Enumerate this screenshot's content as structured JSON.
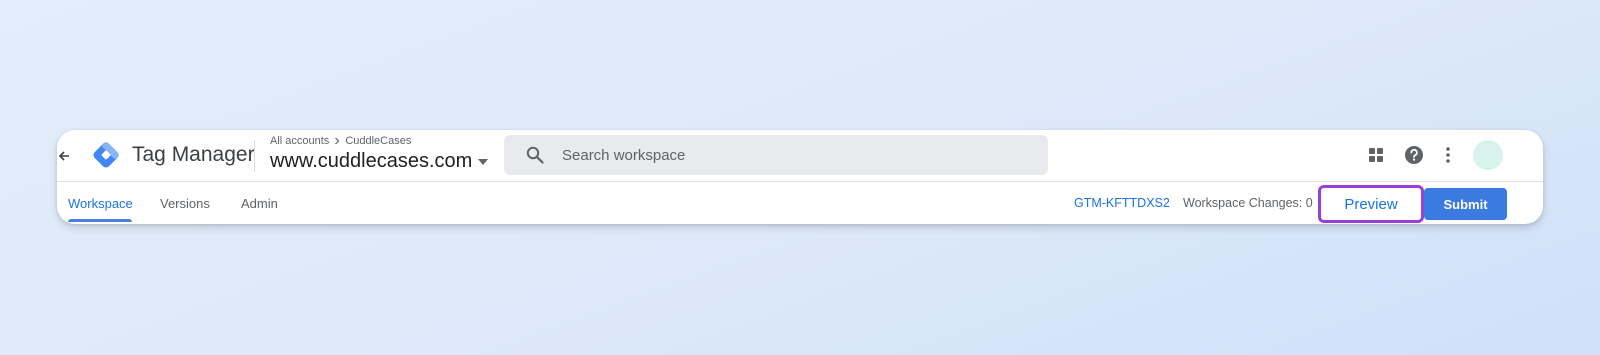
{
  "app": {
    "name": "Tag Manager"
  },
  "breadcrumb": {
    "root": "All accounts",
    "account": "CuddleCases"
  },
  "container": {
    "name": "www.cuddlecases.com",
    "id": "GTM-KFTTDXS2"
  },
  "search": {
    "placeholder": "Search workspace"
  },
  "tabs": [
    {
      "label": "Workspace",
      "active": true
    },
    {
      "label": "Versions",
      "active": false
    },
    {
      "label": "Admin",
      "active": false
    }
  ],
  "workspace": {
    "changes_label": "Workspace Changes: 0"
  },
  "actions": {
    "preview_label": "Preview",
    "submit_label": "Submit"
  },
  "icons": {
    "back": "arrow-left-icon",
    "logo": "tag-manager-logo",
    "caret": "caret-down-icon",
    "search": "search-icon",
    "apps": "apps-grid-icon",
    "help": "help-icon",
    "more": "more-vert-icon"
  },
  "colors": {
    "accent": "#1a73e8",
    "submit": "#3b7be0",
    "preview_highlight": "#9b3fd8",
    "avatar": "#d8f2ec"
  }
}
